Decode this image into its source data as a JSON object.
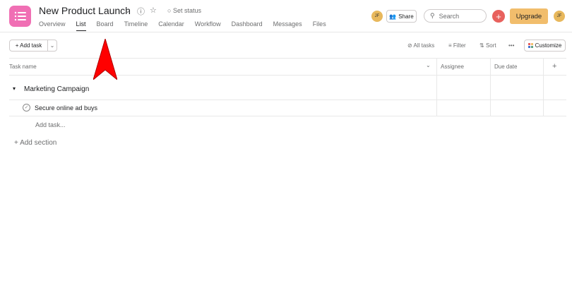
{
  "project": {
    "title": "New Product Launch",
    "status": "Set status",
    "icon": "list-icon",
    "color": "#f06fb4"
  },
  "tabs": [
    {
      "label": "Overview"
    },
    {
      "label": "List",
      "active": true
    },
    {
      "label": "Board"
    },
    {
      "label": "Timeline"
    },
    {
      "label": "Calendar"
    },
    {
      "label": "Workflow"
    },
    {
      "label": "Dashboard"
    },
    {
      "label": "Messages"
    },
    {
      "label": "Files"
    }
  ],
  "header": {
    "member_initials": "JF",
    "share": "Share",
    "search_placeholder": "Search",
    "upgrade": "Upgrade",
    "user_initials": "JF"
  },
  "toolbar": {
    "add_task": "+ Add task",
    "all_tasks": "All tasks",
    "filter": "Filter",
    "sort": "Sort",
    "more": "•••",
    "customize": "Customize"
  },
  "table": {
    "columns": [
      "Task name",
      "Assignee",
      "Due date",
      "+"
    ]
  },
  "sections": [
    {
      "name": "Marketing Campaign",
      "tasks": [
        {
          "name": "Secure online ad buys"
        }
      ],
      "add_task": "Add task..."
    }
  ],
  "add_section": "+ Add section",
  "annotation": {
    "color": "#ff0000"
  }
}
